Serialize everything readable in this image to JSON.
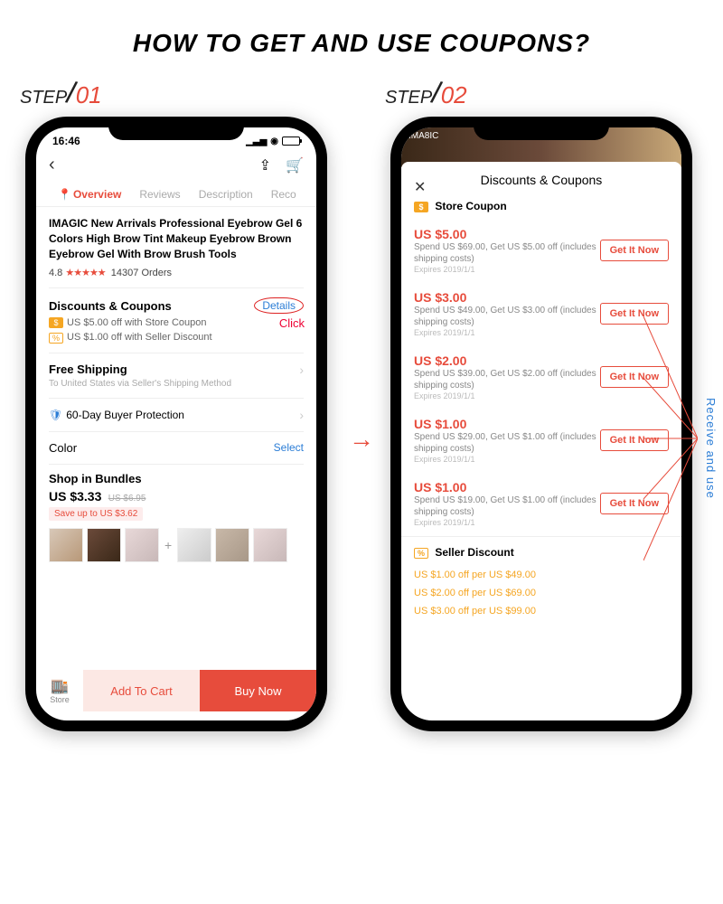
{
  "page_title": "HOW TO GET AND USE COUPONS?",
  "step_label": "STEP",
  "steps": {
    "s1": "01",
    "s2": "02"
  },
  "arrow": "→",
  "side_label": "Receive and use",
  "phone1": {
    "time": "16:46",
    "tabs": {
      "overview": "Overview",
      "reviews": "Reviews",
      "description": "Description",
      "reco": "Reco"
    },
    "product_title": "IMAGIC New Arrivals  Professional Eyebrow Gel 6 Colors High Brow Tint Makeup Eyebrow Brown Eyebrow Gel With Brow Brush Tools",
    "rating": "4.8",
    "stars": "★★★★★",
    "orders": "14307 Orders",
    "discounts_title": "Discounts & Coupons",
    "details": "Details",
    "click": "Click",
    "disc1": "US $5.00 off with Store Coupon",
    "disc2": "US $1.00 off with Seller Discount",
    "free_ship": "Free Shipping",
    "ship_sub": "To United States via Seller's Shipping Method",
    "buyer_prot": "60-Day Buyer Protection",
    "color_label": "Color",
    "select": "Select",
    "bundles_title": "Shop in Bundles",
    "bundle_price": "US $3.33",
    "bundle_old": "US $6.95",
    "bundle_save": "Save up to US $3.62",
    "store": "Store",
    "add_cart": "Add To Cart",
    "buy_now": "Buy Now"
  },
  "phone2": {
    "hero_brand": "IMA8IC",
    "modal_title": "Discounts & Coupons",
    "store_coupon": "Store Coupon",
    "get_it": "Get It Now",
    "coupons": [
      {
        "amt": "US $5.00",
        "desc": "Spend US $69.00, Get US $5.00 off (includes shipping costs)",
        "exp": "Expires 2019/1/1"
      },
      {
        "amt": "US $3.00",
        "desc": "Spend US $49.00, Get US $3.00 off (includes shipping costs)",
        "exp": "Expires 2019/1/1"
      },
      {
        "amt": "US $2.00",
        "desc": "Spend US $39.00, Get US $2.00 off (includes shipping costs)",
        "exp": "Expires 2019/1/1"
      },
      {
        "amt": "US $1.00",
        "desc": "Spend US $29.00, Get US $1.00 off (includes shipping costs)",
        "exp": "Expires 2019/1/1"
      },
      {
        "amt": "US $1.00",
        "desc": "Spend US $19.00, Get US $1.00 off (includes shipping costs)",
        "exp": "Expires 2019/1/1"
      }
    ],
    "seller_discount": "Seller Discount",
    "seller_lines": [
      "US $1.00 off per US $49.00",
      "US $2.00 off per US $69.00",
      "US $3.00 off per US $99.00"
    ]
  }
}
